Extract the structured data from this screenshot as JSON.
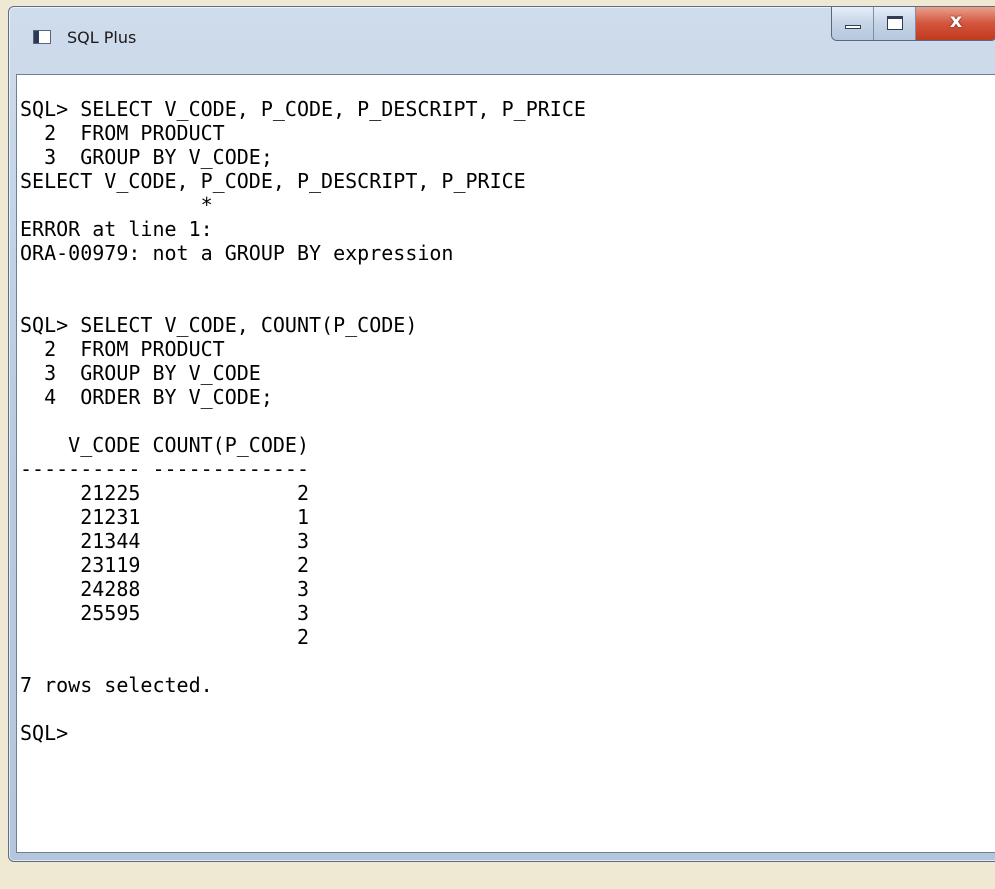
{
  "window": {
    "title": "SQL Plus",
    "icon": "sqlplus-app-icon",
    "close_label": "x"
  },
  "console": {
    "lines": [
      "SQL> SELECT V_CODE, P_CODE, P_DESCRIPT, P_PRICE",
      "  2  FROM PRODUCT",
      "  3  GROUP BY V_CODE;",
      "SELECT V_CODE, P_CODE, P_DESCRIPT, P_PRICE",
      "               *",
      "ERROR at line 1:",
      "ORA-00979: not a GROUP BY expression",
      "",
      "",
      "SQL> SELECT V_CODE, COUNT(P_CODE)",
      "  2  FROM PRODUCT",
      "  3  GROUP BY V_CODE",
      "  4  ORDER BY V_CODE;",
      "",
      "    V_CODE COUNT(P_CODE)",
      "---------- -------------",
      "     21225             2",
      "     21231             1",
      "     21344             3",
      "     23119             2",
      "     24288             3",
      "     25595             3",
      "                       2",
      "",
      "7 rows selected.",
      "",
      "SQL>"
    ]
  }
}
